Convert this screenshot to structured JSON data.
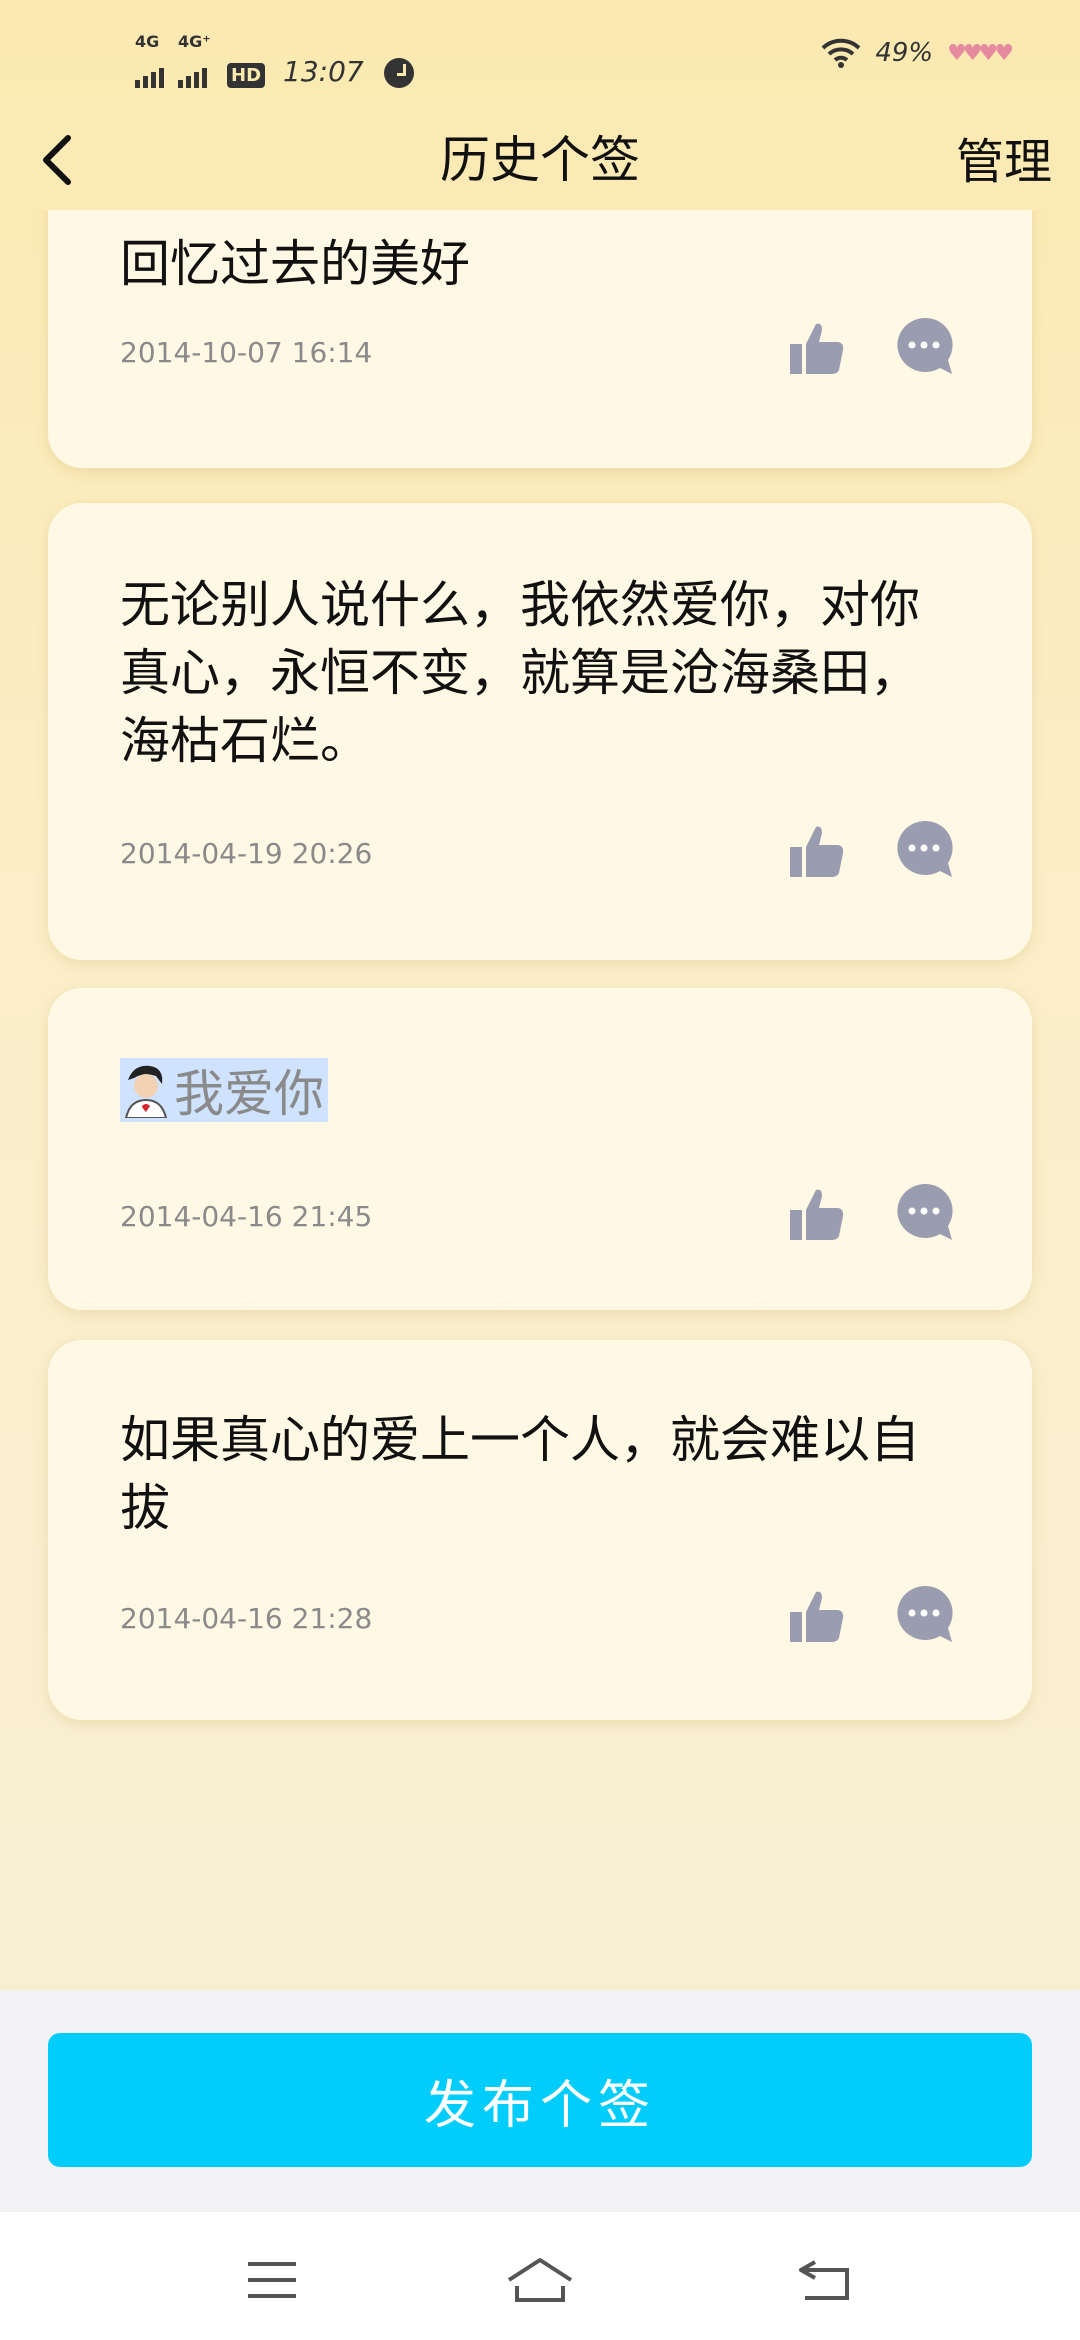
{
  "status_bar": {
    "net1": "4G",
    "net2": "4G⁺",
    "hd": "HD",
    "time": "13:07",
    "battery": "49%"
  },
  "header": {
    "title": "历史个签",
    "manage_label": "管理"
  },
  "signatures": [
    {
      "text": "回忆过去的美好",
      "date": "2014-10-07 16:14"
    },
    {
      "text": "无论别人说什么，我依然爱你，对你真心，永恒不变，就算是沧海桑田，海枯石烂。",
      "date": "2014-04-19 20:26"
    },
    {
      "text": "我爱你",
      "date": "2014-04-16 21:45"
    },
    {
      "text": "如果真心的爱上一个人，就会难以自拔",
      "date": "2014-04-16 21:28"
    }
  ],
  "publish_label": "发布个签",
  "colors": {
    "accent": "#00cdfc",
    "icon": "#9a9db0"
  },
  "icons": {
    "like": "thumbs-up-icon",
    "comment": "comment-icon"
  }
}
